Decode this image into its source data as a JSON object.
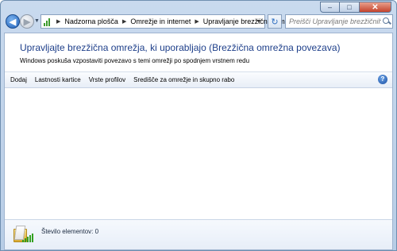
{
  "window": {
    "caption_buttons": {
      "minimize": "–",
      "maximize": "□",
      "close": "✕"
    }
  },
  "navigation": {
    "back_icon": "arrow-left-icon",
    "forward_icon": "arrow-right-icon",
    "breadcrumbs": [
      "Nadzorna plošča",
      "Omrežje in internet",
      "Upravljanje brezžičnih omrežij"
    ],
    "search_placeholder": "Preišči Upravljanje brezžičnih omrežij"
  },
  "header": {
    "title": "Upravljajte brezžična omrežja, ki uporabljajo (Brezžična omrežna povezava)",
    "description": "Windows poskuša vzpostaviti povezavo s temi omrežji po spodnjem vrstnem redu"
  },
  "toolbar": {
    "items": [
      "Dodaj",
      "Lastnosti kartice",
      "Vrste profilov",
      "Središče za omrežje in skupno rabo"
    ],
    "help_label": "?"
  },
  "details": {
    "item_count_label": "Število elementov: 0"
  },
  "colors": {
    "accent": "#1e3f8a",
    "signal_green": "#33a020"
  }
}
